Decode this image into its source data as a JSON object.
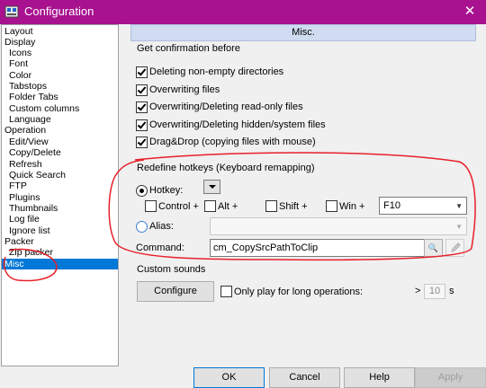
{
  "window": {
    "title": "Configuration",
    "close_glyph": "✕",
    "title_color": "#a8128f"
  },
  "tree": {
    "items": [
      {
        "label": "Layout"
      },
      {
        "label": "Display"
      },
      {
        "label": "Icons"
      },
      {
        "label": "Font"
      },
      {
        "label": "Color"
      },
      {
        "label": "Tabstops"
      },
      {
        "label": "Folder Tabs"
      },
      {
        "label": "Custom columns"
      },
      {
        "label": "Language"
      },
      {
        "label": "Operation"
      },
      {
        "label": "Edit/View"
      },
      {
        "label": "Copy/Delete"
      },
      {
        "label": "Refresh"
      },
      {
        "label": "Quick Search"
      },
      {
        "label": "FTP"
      },
      {
        "label": "Plugins"
      },
      {
        "label": "Thumbnails"
      },
      {
        "label": "Log file"
      },
      {
        "label": "Ignore list"
      },
      {
        "label": "Packer"
      },
      {
        "label": "Zip packer"
      },
      {
        "label": "Misc"
      }
    ],
    "selected": "Misc"
  },
  "panel": {
    "header": "Misc.",
    "confirm_section": "Get confirmation before",
    "checkboxes": [
      {
        "label": "Deleting non-empty directories",
        "checked": true
      },
      {
        "label": "Overwriting files",
        "checked": true
      },
      {
        "label": "Overwriting/Deleting read-only files",
        "checked": true
      },
      {
        "label": "Overwriting/Deleting hidden/system files",
        "checked": true
      },
      {
        "label": "Drag&Drop (copying files with mouse)",
        "checked": true
      }
    ],
    "hotkey_section": "Redefine hotkeys (Keyboard remapping)",
    "hotkey_radio": "Hotkey:",
    "modifiers": [
      {
        "label": "Control +",
        "checked": false
      },
      {
        "label": "Alt +",
        "checked": false
      },
      {
        "label": "Shift +",
        "checked": false
      },
      {
        "label": "Win +",
        "checked": false
      }
    ],
    "key_value": "F10",
    "alias_radio": "Alias:",
    "alias_value": "",
    "command_label": "Command:",
    "command_value": "cm_CopySrcPathToClip",
    "search_icon_glyph": "🔍",
    "sounds_section": "Custom sounds",
    "configure_button": "Configure",
    "long_ops_label": "Only play for long operations:",
    "long_ops_checked": false,
    "threshold_prefix": ">",
    "threshold_value": "10",
    "threshold_unit": "s"
  },
  "buttons": {
    "ok": "OK",
    "cancel": "Cancel",
    "help": "Help",
    "apply": "Apply"
  },
  "annotation_color": "#e8202a"
}
